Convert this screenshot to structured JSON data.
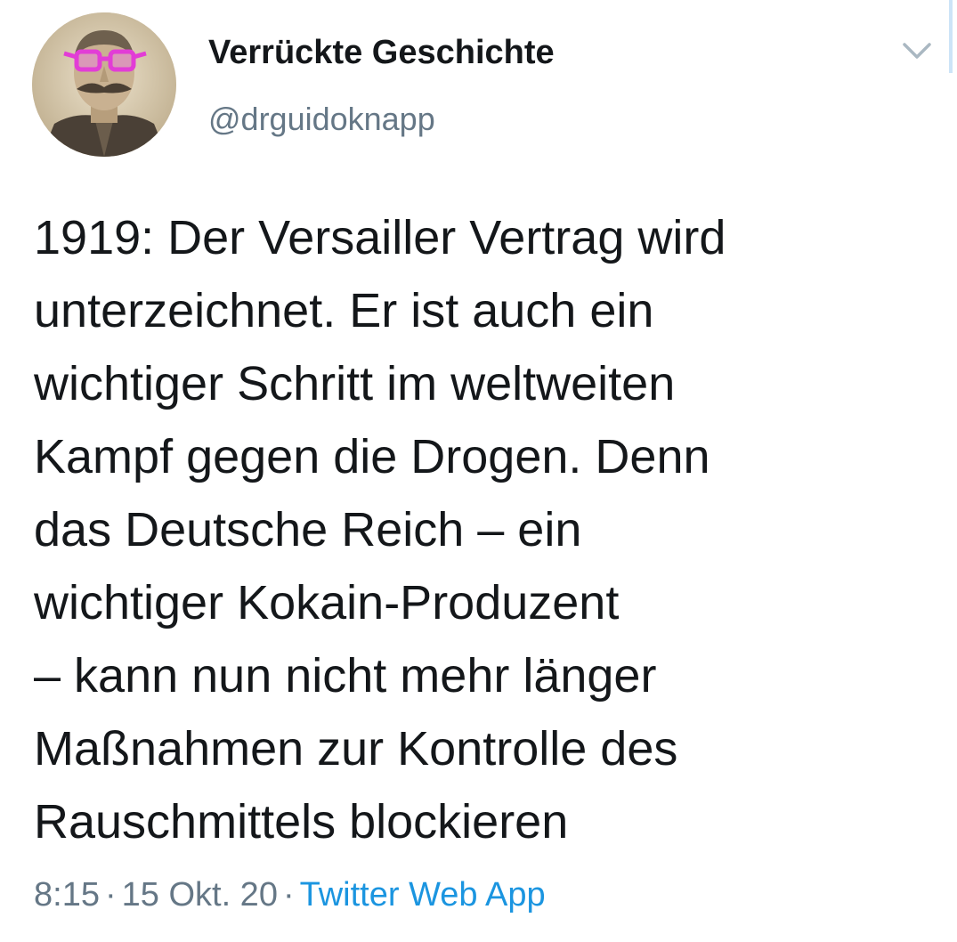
{
  "author": {
    "display_name": "Verrückte Geschichte",
    "handle": "@drguidoknapp",
    "avatar_icon": "portrait-with-pink-glasses"
  },
  "menu": {
    "icon": "chevron-down-icon"
  },
  "tweet": {
    "lines": [
      "1919: Der Versailler Vertrag wird",
      "unterzeichnet. Er ist auch ein",
      "wichtiger Schritt im weltweiten",
      "Kampf gegen die Drogen. Denn",
      "das Deutsche Reich – ein",
      "wichtiger Kokain-Produzent",
      "– kann nun nicht mehr länger",
      "Maßnahmen zur Kontrolle des",
      "Rauschmittels blockieren"
    ]
  },
  "meta": {
    "time": "8:15",
    "separator": "·",
    "date": "15 Okt. 20",
    "source": "Twitter Web App"
  },
  "colors": {
    "text": "#14171a",
    "secondary": "#657786",
    "link": "#1b95e0",
    "glasses": "#e23dd6"
  }
}
